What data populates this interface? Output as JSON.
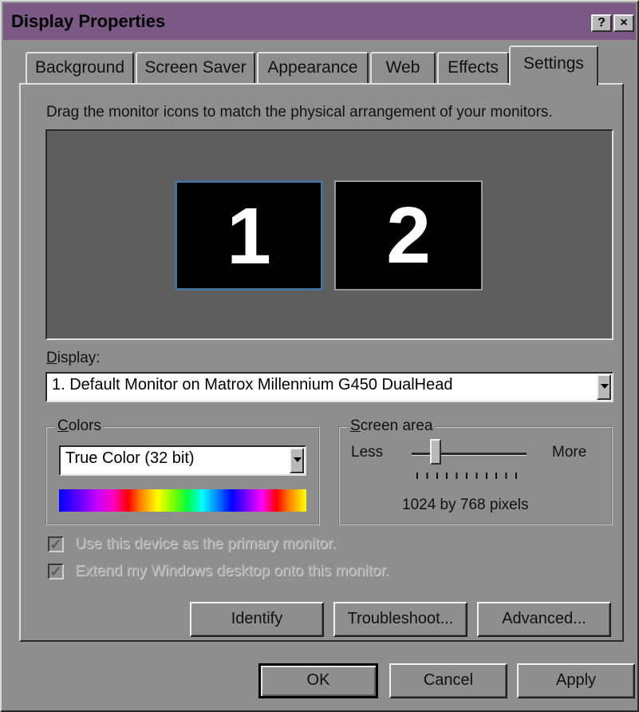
{
  "window": {
    "title": "Display Properties",
    "help_button": "?",
    "close_button": "×"
  },
  "tabs": [
    {
      "label": "Background"
    },
    {
      "label": "Screen Saver"
    },
    {
      "label": "Appearance"
    },
    {
      "label": "Web"
    },
    {
      "label": "Effects"
    },
    {
      "label": "Settings",
      "active": true
    }
  ],
  "settings": {
    "instruction": "Drag the monitor icons to match the physical arrangement of your monitors.",
    "monitors": [
      "1",
      "2"
    ],
    "display_label": "Display:",
    "display_value": "1. Default Monitor on Matrox Millennium G450 DualHead",
    "colors_label": "Colors",
    "colors_value": "True Color (32 bit)",
    "screen_area_label": "Screen area",
    "less_label": "Less",
    "more_label": "More",
    "resolution_text": "1024 by 768 pixels",
    "primary_monitor_label": "Use this device as the primary monitor.",
    "extend_desktop_label": "Extend my Windows desktop onto this monitor.",
    "identify_button": "Identify",
    "troubleshoot_button": "Troubleshoot...",
    "advanced_button": "Advanced..."
  },
  "footer": {
    "ok_button": "OK",
    "cancel_button": "Cancel",
    "apply_button": "Apply"
  },
  "colors": {
    "title_bar": "#7a5a85",
    "dialog_face": "#8e8e8e",
    "monitor_preview_bg": "#5e5e5e",
    "selected_monitor_border": "#4a6e9a"
  }
}
